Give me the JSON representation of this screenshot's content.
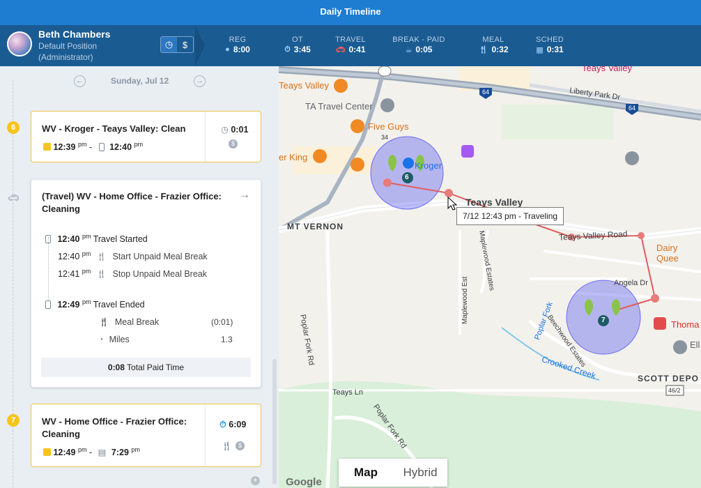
{
  "app": {
    "title": "Daily Timeline"
  },
  "user": {
    "name": "Beth Chambers",
    "position": "Default Position",
    "role": "(Administrator)"
  },
  "stats": [
    {
      "label": "REG",
      "value": "8:00",
      "icon": "clock-icon"
    },
    {
      "label": "OT",
      "value": "3:45",
      "icon": "stopwatch-icon"
    },
    {
      "label": "TRAVEL",
      "value": "0:41",
      "icon": "car-icon"
    },
    {
      "label": "BREAK - PAID",
      "value": "0:05",
      "icon": "coffee-icon"
    },
    {
      "label": "MEAL",
      "value": "0:32",
      "icon": "fork-knife-icon"
    },
    {
      "label": "SCHED",
      "value": "0:31",
      "icon": "calendar-icon"
    }
  ],
  "date": "Sunday, Jul 12",
  "entries": [
    {
      "num": "6",
      "title": "WV - Kroger - Teays Valley: Clean",
      "start": "12:39",
      "start_ampm": "pm",
      "end": "12:40",
      "end_ampm": "pm",
      "duration": "0:01",
      "dash": "-"
    },
    {
      "title": "(Travel) WV - Home Office - Frazier Office: Cleaning",
      "events": [
        {
          "time": "12:40",
          "ampm": "pm",
          "label": "Travel Started"
        },
        {
          "time": "12:40",
          "ampm": "pm",
          "label": "Start Unpaid Meal Break"
        },
        {
          "time": "12:41",
          "ampm": "pm",
          "label": "Stop Unpaid Meal Break"
        },
        {
          "time": "12:49",
          "ampm": "pm",
          "label": "Travel Ended"
        }
      ],
      "details": [
        {
          "label": "Meal Break",
          "value": "(0:01)"
        },
        {
          "label": "Miles",
          "value": "1.3"
        }
      ],
      "total_time": "0:08",
      "total_label": "Total Paid Time"
    },
    {
      "num": "7",
      "title": "WV - Home Office - Frazier Office: Cleaning",
      "start": "12:49",
      "start_ampm": "pm",
      "end": "7:29",
      "end_ampm": "pm",
      "duration": "6:09",
      "dash": "-"
    }
  ],
  "map": {
    "tabs": [
      "Map",
      "Hybrid"
    ],
    "tooltip": "7/12 12:43 pm - Traveling",
    "labels": {
      "teays_valley_top": "Teays Valley",
      "teays_valley_left": "Teays Valley",
      "ta": "TA Travel Center",
      "five_guys": "Five Guys",
      "burger": "er King",
      "kroger": "Kroger",
      "teays_valley_main": "Teays Valley",
      "mt_vernon": "MT VERNON",
      "teays_valley_rd": "Teays Valley Road",
      "dairy": "Dairy Quee",
      "liberty": "Liberty Park Dr",
      "angela": "Angela Dr",
      "thoma": "Thoma",
      "ell": "Ell",
      "scott": "SCOTT DEPO",
      "poplar1": "Poplar Fork Rd",
      "poplar2": "Poplar Fork Rd",
      "poplar3": "Poplar Fork",
      "maplewood_est": "Maplewood Est",
      "maplewood_estates": "Maplewood Estates",
      "beechwood": "Beechwood Estates",
      "crooked": "Crooked Creek",
      "teays_ln": "Teays Ln",
      "r34": "34",
      "r64a": "64",
      "r64b": "64",
      "r462": "46/2",
      "pin6": "6",
      "pin7": "7",
      "google": "Google"
    }
  }
}
